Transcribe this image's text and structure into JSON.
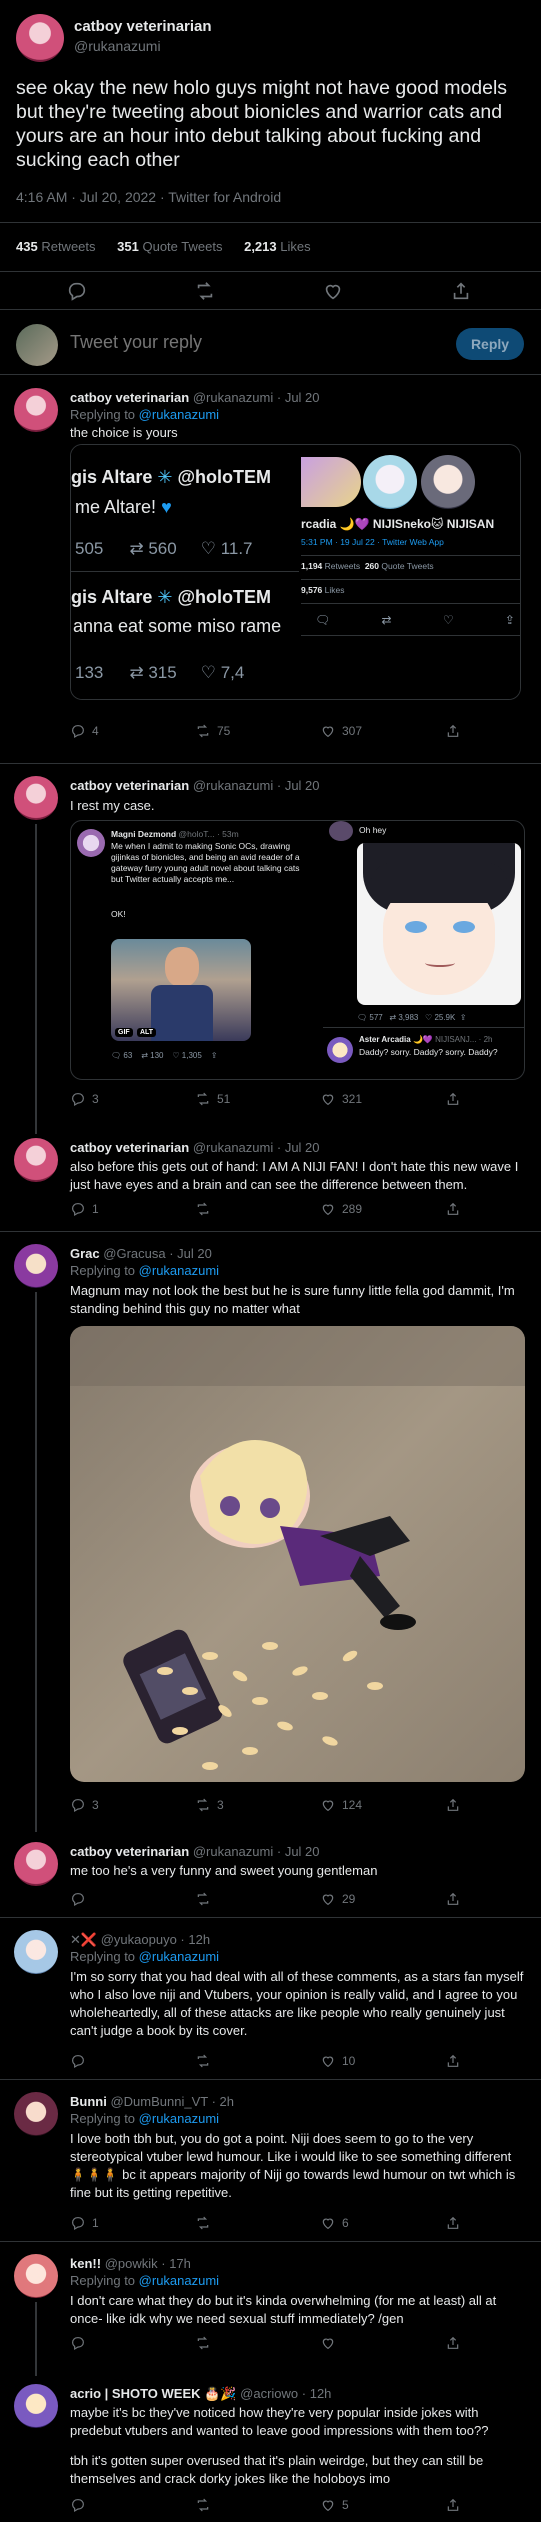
{
  "main_tweet": {
    "name": "catboy veterinarian",
    "handle": "@rukanazumi",
    "text": "see okay the new holo guys might not have good models but they're tweeting about bionicles and warrior cats and yours are an hour into debut talking about fucking and sucking each other",
    "meta": "4:16 AM · Jul 20, 2022 · Twitter for Android",
    "stats": {
      "retweets_count": "435",
      "retweets_label": "Retweets",
      "quotes_count": "351",
      "quotes_label": "Quote Tweets",
      "likes_count": "2,213",
      "likes_label": "Likes"
    }
  },
  "reply_composer": {
    "placeholder": "Tweet your reply",
    "button": "Reply"
  },
  "replies": [
    {
      "name": "catboy veterinarian",
      "handle": "@rukanazumi",
      "time": "Jul 20",
      "replying_prefix": "Replying to",
      "replying_to": "@rukanazumi",
      "text": "the choice is yours",
      "replies": "4",
      "retweets": "75",
      "likes": "307",
      "image": {
        "left_top_name": "gis Altare",
        "left_top_handle": "@holoTEM",
        "left_top_text": "me Altare!",
        "left_top_replies": "505",
        "left_top_retweets": "560",
        "left_top_likes": "11.7",
        "left_bottom_name": "gis Altare",
        "left_bottom_handle": "@holoTEM",
        "left_bottom_text": "anna eat some miso rame",
        "left_bottom_replies": "133",
        "left_bottom_retweets": "315",
        "left_bottom_likes": "7,4",
        "right_name_a": "rcadia",
        "right_name_b": "NIJIS",
        "right_name_c": "neko",
        "right_name_d": "NIJISAN",
        "right_meta": "5:31 PM · 19 Jul 22 · Twitter Web App",
        "right_rt_count": "1,194",
        "right_rt_label": "Retweets",
        "right_qt_count": "260",
        "right_qt_label": "Quote Tweets",
        "right_likes_count": "9,576",
        "right_likes_label": "Likes"
      }
    },
    {
      "name": "catboy veterinarian",
      "handle": "@rukanazumi",
      "time": "Jul 20",
      "text": "I rest my case.",
      "replies": "3",
      "retweets": "51",
      "likes": "321",
      "image": {
        "left_name": "Magni Dezmond",
        "left_handle": "@holoT...",
        "left_time": "53m",
        "left_text": "Me when I admit to making Sonic OCs, drawing gijinkas of bionicles, and being an avid reader of a gateway furry young adult novel about talking cats but Twitter actually accepts me...",
        "left_ok": "OK!",
        "left_gif": "GIF",
        "left_alt": "ALT",
        "left_replies": "63",
        "left_retweets": "130",
        "left_likes": "1,305",
        "right_top_text": "Oh hey",
        "right_replies": "577",
        "right_retweets": "3,983",
        "right_likes": "25.9K",
        "right_name": "Aster Arcadia",
        "right_handle": "NIJISANJ...",
        "right_time": "2h",
        "right_text": "Daddy? sorry. Daddy? sorry. Daddy?"
      }
    },
    {
      "name": "catboy veterinarian",
      "handle": "@rukanazumi",
      "time": "Jul 20",
      "text": "also before this gets out of hand: I AM A NIJI FAN! I don't hate this new wave I just have eyes and a brain and can see the difference between them.",
      "replies": "1",
      "retweets": "",
      "likes": "289"
    },
    {
      "name": "Grac",
      "handle": "@Gracusa",
      "time": "Jul 20",
      "replying_prefix": "Replying to",
      "replying_to": "@rukanazumi",
      "text": "Magnum may not look the best but he is sure funny little fella god dammit, I'm standing behind this guy no matter what",
      "replies": "3",
      "retweets": "3",
      "likes": "124"
    },
    {
      "name": "catboy veterinarian",
      "handle": "@rukanazumi",
      "time": "Jul 20",
      "text": "me too he's a very funny and sweet young gentleman",
      "replies": "",
      "retweets": "",
      "likes": "29"
    },
    {
      "name": "✕❌",
      "handle": "@yukaopuyo",
      "time": "12h",
      "replying_prefix": "Replying to",
      "replying_to": "@rukanazumi",
      "text": "I'm so sorry that you had deal with all of these comments, as a stars fan myself who I also love niji and Vtubers, your opinion is really valid, and I agree to you wholeheartedly, all of these attacks are like people who really genuinely just can't judge a book by its cover.",
      "replies": "",
      "retweets": "",
      "likes": "10"
    },
    {
      "name": "Bunni",
      "handle": "@DumBunni_VT",
      "time": "2h",
      "replying_prefix": "Replying to",
      "replying_to": "@rukanazumi",
      "text": "I love both tbh but, you do got a point. Niji does seem to go to the very stereotypical vtuber lewd humour. Like i would like to see something different 🧍🧍🧍 bc it appears majority of Niji go towards lewd humour on twt which is fine but its getting repetitive.",
      "replies": "1",
      "retweets": "",
      "likes": "6"
    },
    {
      "name": "ken!!",
      "handle": "@powkik",
      "time": "17h",
      "replying_prefix": "Replying to",
      "replying_to": "@rukanazumi",
      "text": "I don't care what they do but it's kinda overwhelming (for me at least) all at once- like idk why we need sexual stuff immediately? /gen",
      "replies": "",
      "retweets": "",
      "likes": ""
    },
    {
      "name": "acrio | SHOTO WEEK 🎂🎉",
      "handle": "@acriowo",
      "time": "12h",
      "text": "maybe it's bc they've noticed how they're very popular inside jokes with predebut vtubers and wanted to leave good impressions with them too??",
      "text2": "tbh it's gotten super overused that it's plain weirdge, but they can still be themselves and crack dorky jokes like the holoboys imo",
      "replies": "",
      "retweets": "",
      "likes": "5"
    }
  ],
  "colors": {
    "accent": "#1d9bf0",
    "text": "#e7e9ea",
    "muted": "#71767b",
    "border": "#2f3336",
    "background": "#000000"
  }
}
